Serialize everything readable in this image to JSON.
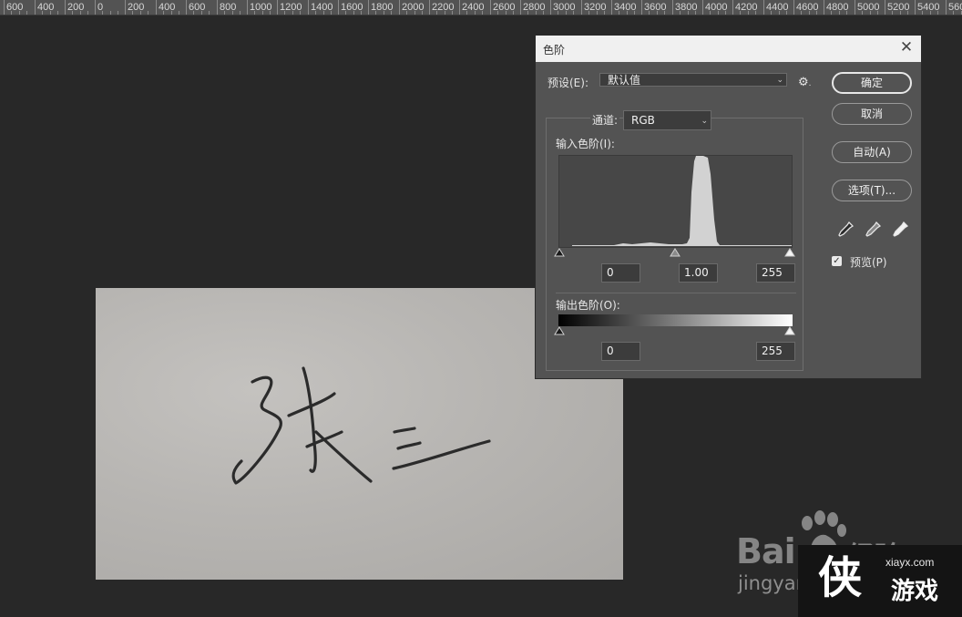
{
  "ruler": {
    "ticks": [
      "600",
      "400",
      "200",
      "0",
      "200",
      "400",
      "600",
      "800",
      "1000",
      "1200",
      "1400",
      "1600",
      "1800",
      "2000",
      "2200",
      "2400",
      "2600",
      "2800",
      "3000",
      "3200",
      "3400",
      "3600",
      "3800",
      "4000",
      "4200",
      "4400",
      "4600",
      "4800",
      "5000",
      "5200",
      "5400",
      "560"
    ]
  },
  "canvas": {
    "handwriting": "张三"
  },
  "levels_dialog": {
    "title": "色阶",
    "preset_label": "预设(E):",
    "preset_value": "默认值",
    "channel_label": "通道:",
    "channel_value": "RGB",
    "input_levels_label": "输入色阶(I):",
    "input_black": "0",
    "input_gamma": "1.00",
    "input_white": "255",
    "output_levels_label": "输出色阶(O):",
    "output_black": "0",
    "output_white": "255",
    "buttons": {
      "ok": "确定",
      "cancel": "取消",
      "auto": "自动(A)",
      "options": "选项(T)..."
    },
    "preview_label": "预览(P)",
    "preview_checked": true
  },
  "watermark": {
    "baidu": "Bai",
    "baidu_cn": "经验",
    "jingyan": "jingyan",
    "site_url": "xiayx.com",
    "site_name": "游戏",
    "site_logo_char": "侠"
  }
}
